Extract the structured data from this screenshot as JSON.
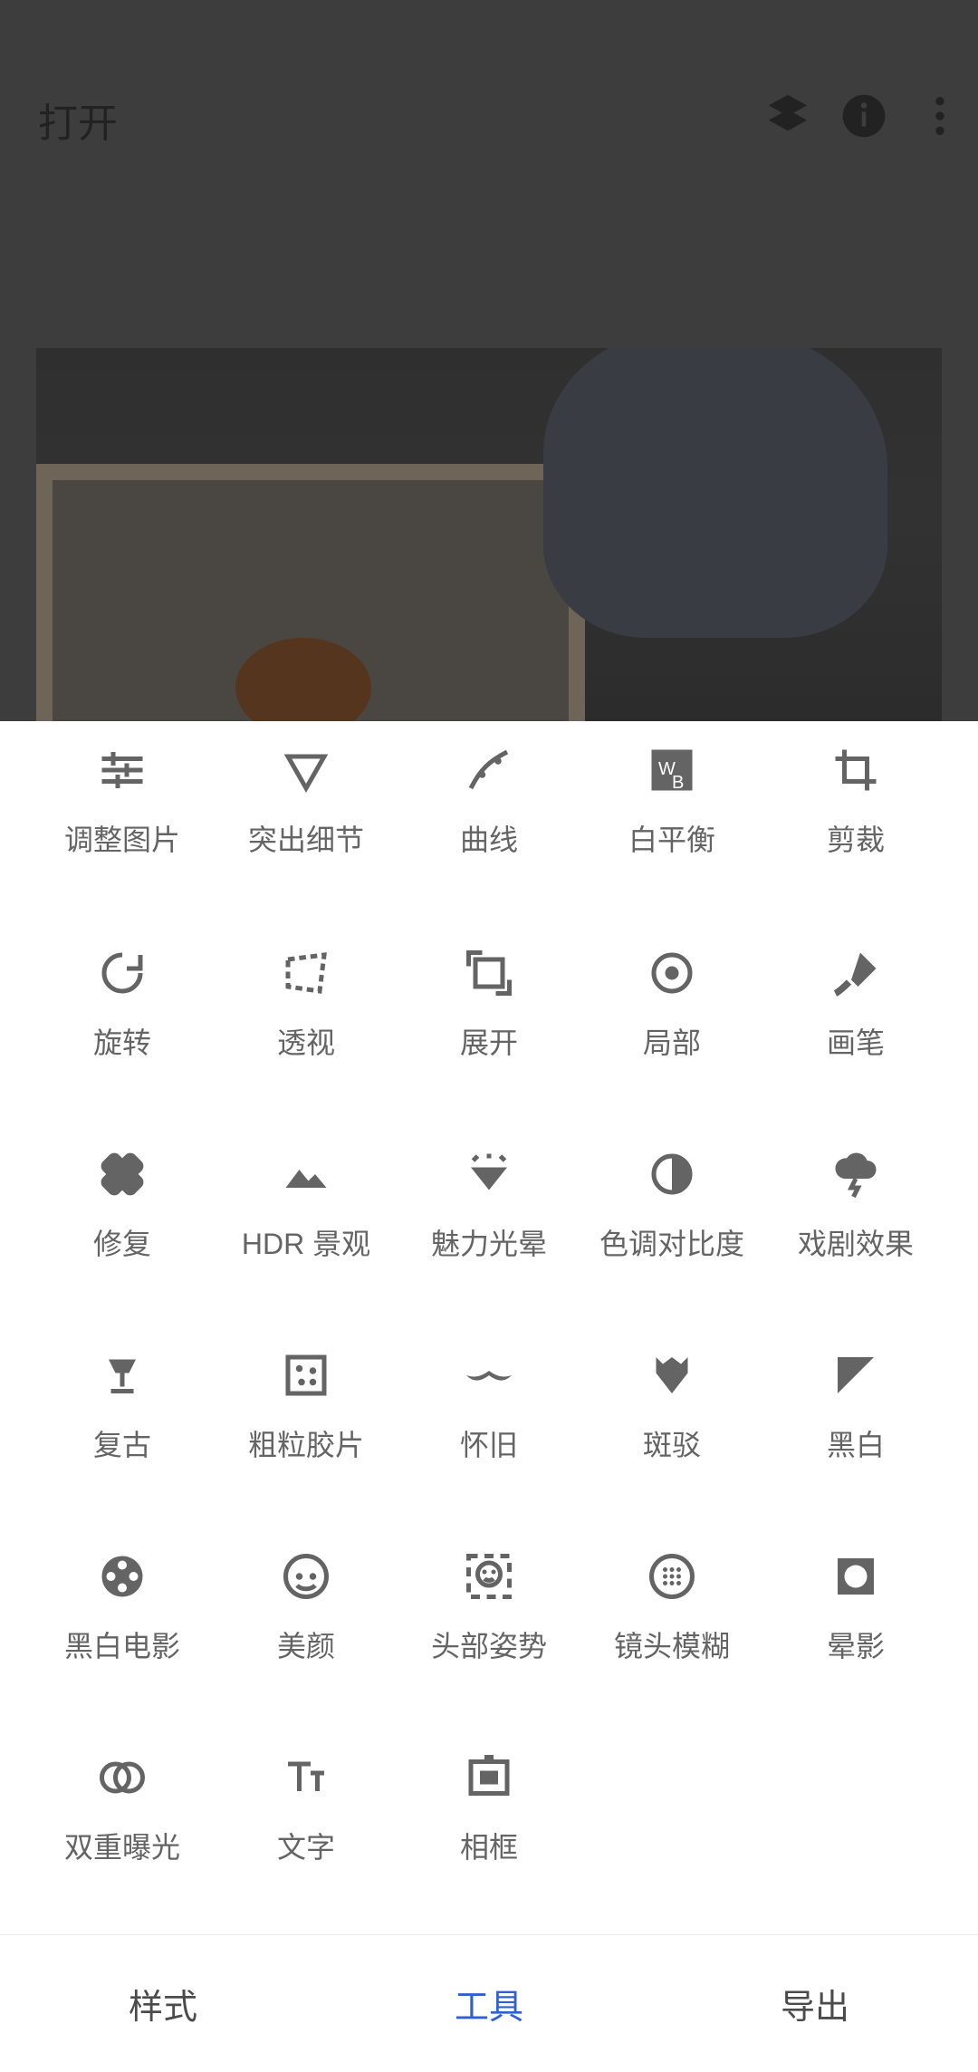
{
  "top_bar": {
    "open_label": "打开",
    "icons": [
      "layers-icon",
      "info-icon",
      "more-vert-icon"
    ]
  },
  "tools": [
    {
      "label": "调整图片",
      "icon": "tune-icon"
    },
    {
      "label": "突出细节",
      "icon": "details-triangle-icon"
    },
    {
      "label": "曲线",
      "icon": "curves-icon"
    },
    {
      "label": "白平衡",
      "icon": "white-balance-icon"
    },
    {
      "label": "剪裁",
      "icon": "crop-icon"
    },
    {
      "label": "旋转",
      "icon": "rotate-icon"
    },
    {
      "label": "透视",
      "icon": "perspective-icon"
    },
    {
      "label": "展开",
      "icon": "expand-icon"
    },
    {
      "label": "局部",
      "icon": "selective-icon"
    },
    {
      "label": "画笔",
      "icon": "brush-icon"
    },
    {
      "label": "修复",
      "icon": "healing-icon"
    },
    {
      "label": "HDR 景观",
      "icon": "hdr-landscape-icon"
    },
    {
      "label": "魅力光晕",
      "icon": "glamour-glow-icon"
    },
    {
      "label": "色调对比度",
      "icon": "tonal-contrast-icon"
    },
    {
      "label": "戏剧效果",
      "icon": "drama-icon"
    },
    {
      "label": "复古",
      "icon": "vintage-lamp-icon"
    },
    {
      "label": "粗粒胶片",
      "icon": "grainy-film-icon"
    },
    {
      "label": "怀旧",
      "icon": "mustache-icon"
    },
    {
      "label": "斑驳",
      "icon": "grunge-icon"
    },
    {
      "label": "黑白",
      "icon": "black-white-icon"
    },
    {
      "label": "黑白电影",
      "icon": "film-reel-icon"
    },
    {
      "label": "美颜",
      "icon": "face-icon"
    },
    {
      "label": "头部姿势",
      "icon": "head-pose-icon"
    },
    {
      "label": "镜头模糊",
      "icon": "lens-blur-icon"
    },
    {
      "label": "晕影",
      "icon": "vignette-icon"
    },
    {
      "label": "双重曝光",
      "icon": "double-exposure-icon"
    },
    {
      "label": "文字",
      "icon": "text-icon"
    },
    {
      "label": "相框",
      "icon": "frame-icon"
    }
  ],
  "bottom_nav": {
    "items": [
      {
        "label": "样式",
        "active": false
      },
      {
        "label": "工具",
        "active": true
      },
      {
        "label": "导出",
        "active": false
      }
    ],
    "colors": {
      "active": "#2f5fd3",
      "inactive": "#4b4b4b"
    }
  }
}
